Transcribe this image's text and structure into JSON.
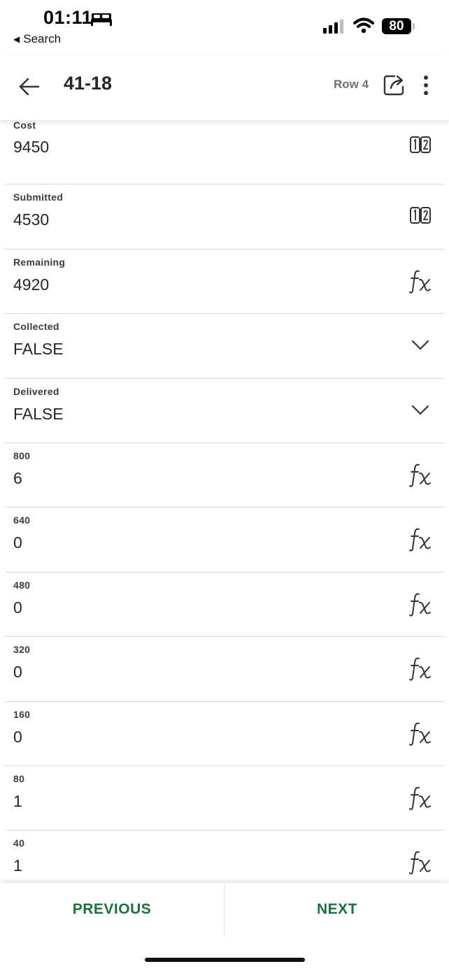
{
  "status_bar": {
    "time": "01:11",
    "back_app": "Search",
    "battery": "80",
    "icons": [
      "bed-icon",
      "signal-icon",
      "wifi-icon",
      "battery-icon"
    ]
  },
  "header": {
    "title": "41-18",
    "row_label": "Row 4",
    "icons": [
      "back-arrow-icon",
      "share-icon",
      "more-vertical-icon"
    ]
  },
  "fields": [
    {
      "label": "Cost",
      "value": "9450",
      "icon": "number-icon"
    },
    {
      "label": "Submitted",
      "value": "4530",
      "icon": "number-icon"
    },
    {
      "label": "Remaining",
      "value": "4920",
      "icon": "formula-icon"
    },
    {
      "label": "Collected",
      "value": "FALSE",
      "icon": "chevron-down-icon"
    },
    {
      "label": "Delivered",
      "value": "FALSE",
      "icon": "chevron-down-icon"
    },
    {
      "label": "800",
      "value": "6",
      "icon": "formula-icon"
    },
    {
      "label": "640",
      "value": "0",
      "icon": "formula-icon"
    },
    {
      "label": "480",
      "value": "0",
      "icon": "formula-icon"
    },
    {
      "label": "320",
      "value": "0",
      "icon": "formula-icon"
    },
    {
      "label": "160",
      "value": "0",
      "icon": "formula-icon"
    },
    {
      "label": "80",
      "value": "1",
      "icon": "formula-icon"
    },
    {
      "label": "40",
      "value": "1",
      "icon": "formula-icon"
    }
  ],
  "footer": {
    "previous_label": "PREVIOUS",
    "next_label": "NEXT"
  },
  "colors": {
    "accent": "#1e6f3e",
    "text": "#262626",
    "divider": "#d8d8d8"
  }
}
